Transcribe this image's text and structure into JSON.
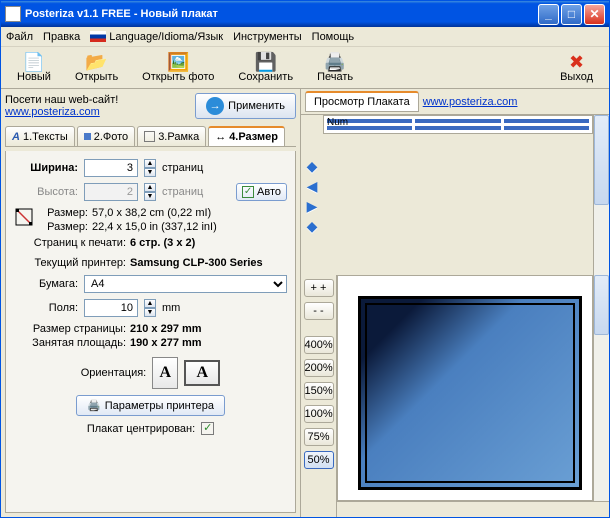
{
  "titlebar": {
    "text": "Posteriza v1.1 FREE - Новый плакат"
  },
  "menu": {
    "file": "Файл",
    "edit": "Правка",
    "lang": "Language/Idioma/Язык",
    "tools": "Инструменты",
    "help": "Помощь"
  },
  "toolbar": {
    "new": "Новый",
    "open": "Открыть",
    "openPhoto": "Открыть фото",
    "save": "Сохранить",
    "print": "Печать",
    "exit": "Выход"
  },
  "leftPanel": {
    "visitLabel": "Посети наш web-сайт!",
    "visitUrl": "www.posteriza.com",
    "applyBtn": "Применить",
    "tabs": {
      "texts": "1.Тексты",
      "photo": "2.Фото",
      "frame": "3.Рамка",
      "size": "4.Размер"
    },
    "size": {
      "widthLabel": "Ширина:",
      "widthVal": "3",
      "heightLabel": "Высота:",
      "heightVal": "2",
      "unitPages": "страниц",
      "autoBtn": "Авто",
      "dimLabel": "Размер:",
      "dimCm": "57,0 x 38,2 cm (0,22 mI)",
      "dimIn": "22,4 x 15,0 in (337,12 inI)",
      "pagesToPrintLabel": "Страниц к печати:",
      "pagesToPrint": "6 стр. (3 x 2)",
      "curPrinterLabel": "Текущий принтер:",
      "curPrinter": "Samsung CLP-300 Series",
      "paperLabel": "Бумага:",
      "paperVal": "A4",
      "marginsLabel": "Поля:",
      "marginsVal": "10",
      "mm": "mm",
      "pageSizeLabel": "Размер страницы:",
      "pageSize": "210 x 297 mm",
      "usedAreaLabel": "Занятая площадь:",
      "usedArea": "190 x 277 mm",
      "orientLabel": "Ориентация:",
      "printerParamsBtn": "Параметры принтера",
      "centeredLabel": "Плакат центрирован:"
    }
  },
  "rightPanel": {
    "tabs": {
      "preview": "Просмотр Плаката",
      "web": "www.posteriza.com"
    },
    "numLabel": "Num",
    "zoom": {
      "z400": "400%",
      "z200": "200%",
      "z150": "150%",
      "z100": "100%",
      "z75": "75%",
      "z50": "50%"
    }
  }
}
